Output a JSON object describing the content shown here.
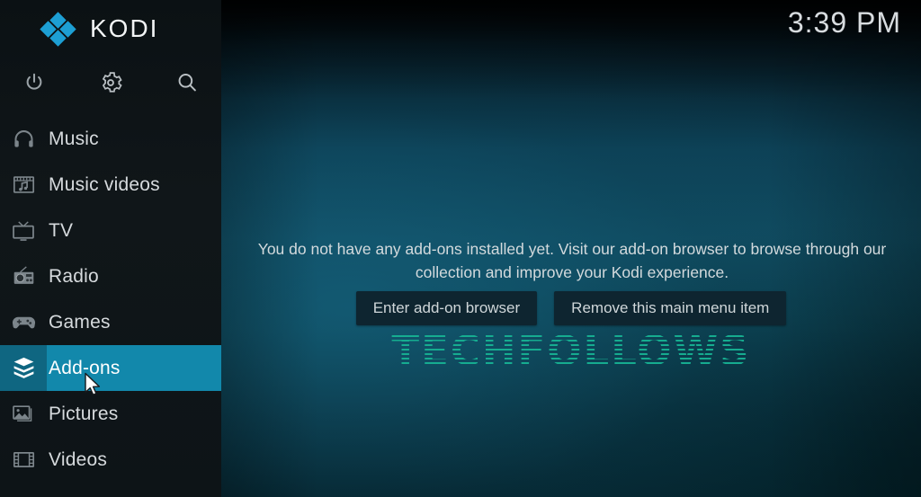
{
  "app": {
    "name": "KODI",
    "logo_color": "#1d9fd4",
    "clock": "3:39 PM"
  },
  "toolbar": {
    "items": [
      {
        "name": "power-icon",
        "label": "Power"
      },
      {
        "name": "gear-icon",
        "label": "Settings"
      },
      {
        "name": "search-icon",
        "label": "Search"
      }
    ]
  },
  "sidebar": {
    "background": "#101619",
    "selected_color": "#1288ab",
    "selected_icon_color": "#0f6681",
    "items": [
      {
        "label": "Music",
        "icon": "headphones-icon",
        "selected": false
      },
      {
        "label": "Music videos",
        "icon": "music-video-icon",
        "selected": false
      },
      {
        "label": "TV",
        "icon": "tv-icon",
        "selected": false
      },
      {
        "label": "Radio",
        "icon": "radio-icon",
        "selected": false
      },
      {
        "label": "Games",
        "icon": "gamepad-icon",
        "selected": false
      },
      {
        "label": "Add-ons",
        "icon": "addons-box-icon",
        "selected": true
      },
      {
        "label": "Pictures",
        "icon": "pictures-icon",
        "selected": false
      },
      {
        "label": "Videos",
        "icon": "videos-film-icon",
        "selected": false
      }
    ]
  },
  "main": {
    "message": "You do not have any add-ons installed yet. Visit our add-on browser to browse through our collection and improve your Kodi experience.",
    "buttons": [
      {
        "label": "Enter add-on browser"
      },
      {
        "label": "Remove this main menu item"
      }
    ],
    "watermark": "TECHFOLLOWS",
    "watermark_color": "#17b293"
  }
}
